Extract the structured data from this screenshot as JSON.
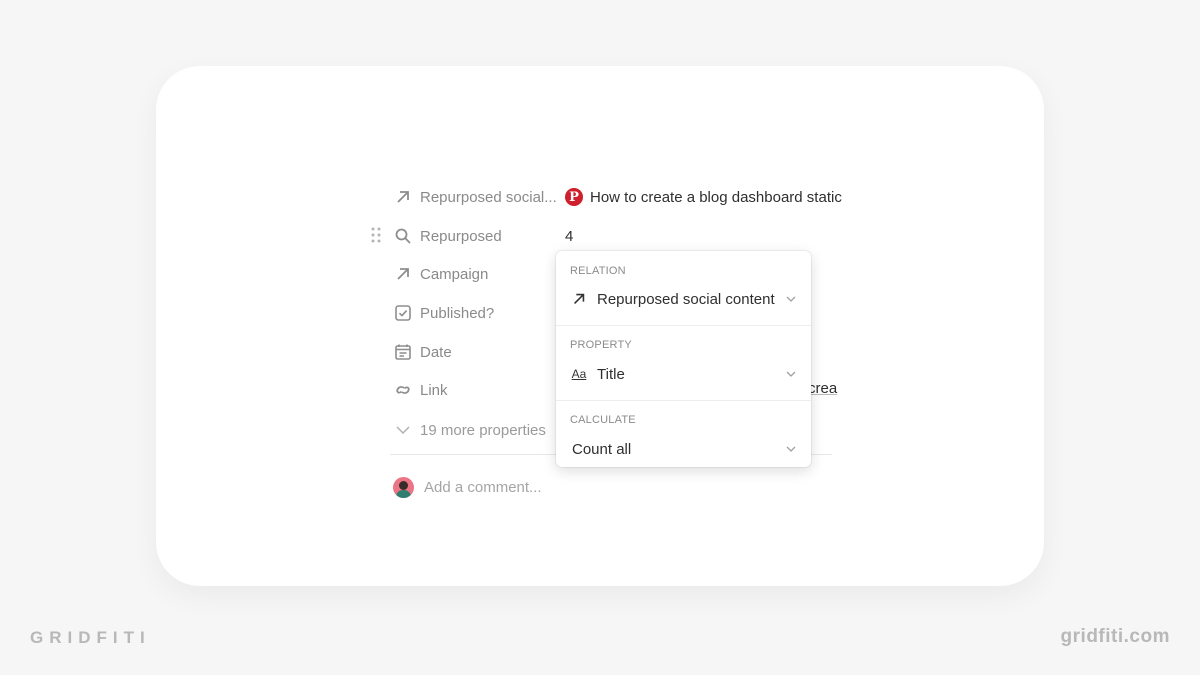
{
  "properties": [
    {
      "icon": "arrow-up-right-icon",
      "label": "Repurposed social...",
      "value": "How to create a blog dashboard static",
      "value_icon": "pinterest-icon"
    },
    {
      "icon": "search-icon",
      "label": "Repurposed",
      "value": "4"
    },
    {
      "icon": "arrow-up-right-icon",
      "label": "Campaign",
      "value": ""
    },
    {
      "icon": "checkbox-icon",
      "label": "Published?",
      "value": ""
    },
    {
      "icon": "calendar-icon",
      "label": "Date",
      "value": ""
    },
    {
      "icon": "link-icon",
      "label": "Link",
      "value": "crea"
    }
  ],
  "more_properties": "19 more properties",
  "comment": {
    "placeholder": "Add a comment..."
  },
  "rollup_popup": {
    "relation": {
      "label": "RELATION",
      "value": "Repurposed social content"
    },
    "property": {
      "label": "PROPERTY",
      "value": "Title",
      "icon_text": "Aa"
    },
    "calculate": {
      "label": "CALCULATE",
      "value": "Count all"
    }
  },
  "branding": {
    "left": "GRIDFITI",
    "right": "gridfiti.com"
  },
  "colors": {
    "pinterest": "#cf1f2c",
    "background": "#f6f6f6"
  }
}
